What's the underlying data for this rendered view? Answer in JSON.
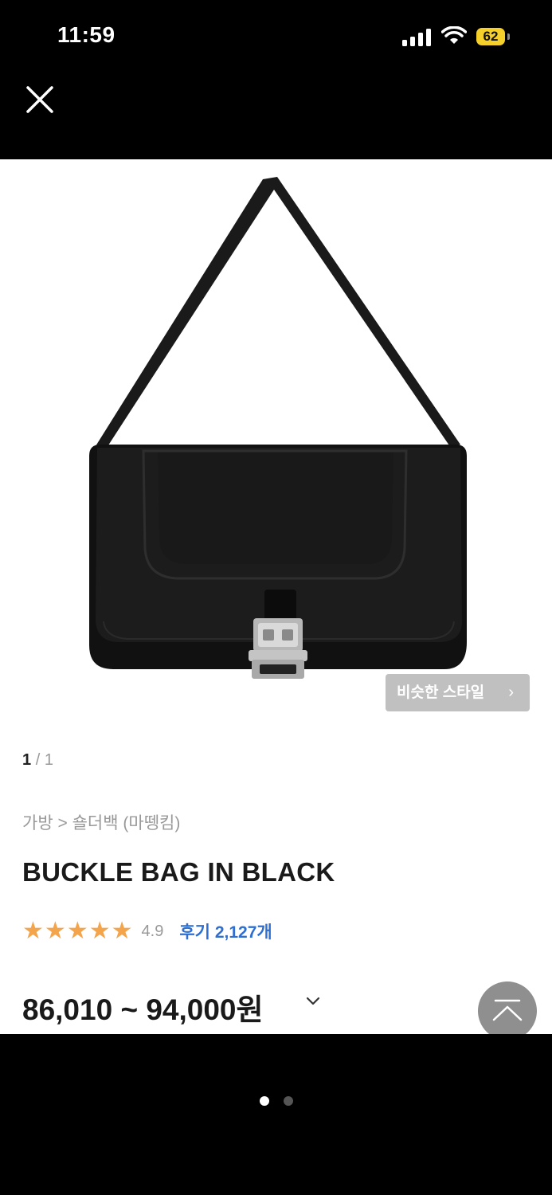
{
  "status_bar": {
    "time": "11:59",
    "battery": "62",
    "battery_color": "#f5d02b"
  },
  "topbar": {
    "close_icon": "close-icon"
  },
  "product": {
    "image_badge": "비슷한 스타일",
    "image_badge_icon": "chevron-right-icon",
    "pager_current": "1",
    "pager_separator": "/",
    "pager_total": "1",
    "breadcrumb": {
      "category": "가방",
      "separator": ">",
      "subcategory": "숄더백 (마뗑킴)"
    },
    "title": "BUCKLE BAG IN BLACK",
    "stars": 5,
    "rating": "4.9",
    "reviews": "후기 2,127개",
    "price": "86,010 ~ 94,000원",
    "price_toggle_icon": "chevron-down-icon",
    "scroll_top_icon": "scroll-to-top-icon"
  },
  "pagination_dots": {
    "count": 2,
    "active_index": 0
  },
  "colors": {
    "star": "#f4a54c",
    "review_link": "#2f6fcf",
    "background": "#ffffff"
  }
}
